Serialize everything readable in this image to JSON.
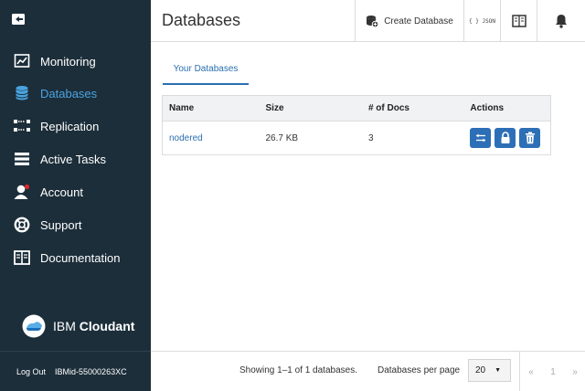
{
  "sidebar": {
    "items": [
      {
        "label": "Monitoring",
        "icon": "monitoring-icon"
      },
      {
        "label": "Databases",
        "icon": "database-icon",
        "active": true
      },
      {
        "label": "Replication",
        "icon": "replication-icon"
      },
      {
        "label": "Active Tasks",
        "icon": "active-tasks-icon"
      },
      {
        "label": "Account",
        "icon": "account-icon"
      },
      {
        "label": "Support",
        "icon": "support-icon"
      },
      {
        "label": "Documentation",
        "icon": "documentation-icon"
      }
    ],
    "brand": {
      "prefix": "IBM",
      "name": "Cloudant"
    },
    "footer": {
      "logout": "Log Out",
      "user": "IBMid-55000263XC"
    }
  },
  "header": {
    "title": "Databases",
    "create_db": "Create Database",
    "json": "{ } JSON"
  },
  "tabs": [
    {
      "label": "Your Databases"
    }
  ],
  "table": {
    "columns": [
      "Name",
      "Size",
      "# of Docs",
      "Actions"
    ],
    "rows": [
      {
        "name": "nodered",
        "size": "26.7 KB",
        "docs": "3"
      }
    ]
  },
  "footer": {
    "showing": "Showing 1–1 of 1 databases.",
    "per_page_label": "Databases per page",
    "per_page_value": "20",
    "page_prev": "«",
    "page_current": "1",
    "page_next": "»"
  },
  "colors": {
    "sidebar_bg": "#1c2e3a",
    "accent": "#2a6fb1",
    "active_nav": "#4aa3e0"
  }
}
